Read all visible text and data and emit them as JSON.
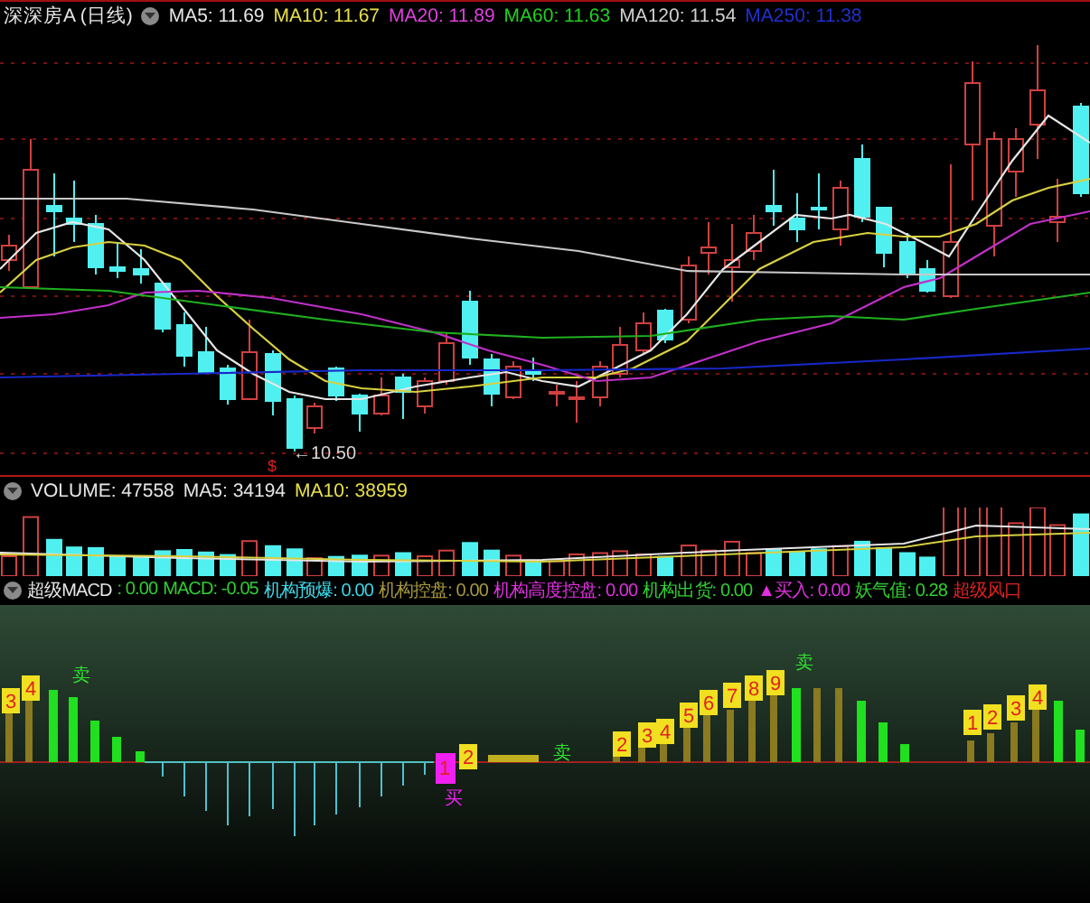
{
  "main_panel": {
    "title": "深深房A (日线)",
    "indicators": [
      {
        "label": "MA5: 11.69",
        "color": "#e6e6e6"
      },
      {
        "label": "MA10: 11.67",
        "color": "#e8e04a"
      },
      {
        "label": "MA20: 11.89",
        "color": "#e040e0"
      },
      {
        "label": "MA60: 11.63",
        "color": "#20d020"
      },
      {
        "label": "MA120: 11.54",
        "color": "#d0d0d0"
      },
      {
        "label": "MA250: 11.38",
        "color": "#2030d0"
      }
    ],
    "low_marker": "←10.50",
    "signal_marker": "$"
  },
  "volume_panel": {
    "indicators": [
      {
        "label": "VOLUME: 47558",
        "color": "#e6e6e6"
      },
      {
        "label": "MA5: 34194",
        "color": "#e6e6e6"
      },
      {
        "label": "MA10: 38959",
        "color": "#e8e04a"
      }
    ]
  },
  "macd_panel": {
    "title": "超级MACD",
    "indicators": [
      {
        "label": ": 0.00",
        "color": "#30d030"
      },
      {
        "label": "MACD: -0.05",
        "color": "#30d030"
      },
      {
        "label": "机构预爆: 0.00",
        "color": "#40d8e8"
      },
      {
        "label": "机构控盘: 0.00",
        "color": "#a89a40"
      },
      {
        "label": "机构高度控盘: 0.00",
        "color": "#e030e0"
      },
      {
        "label": "机构出货: 0.00",
        "color": "#30d030"
      },
      {
        "label": "▲买入: 0.00",
        "color": "#e030e0"
      },
      {
        "label": "妖气值: 0.28",
        "color": "#30d030"
      },
      {
        "label": "超级风口",
        "color": "#e02020"
      }
    ],
    "signals": [
      {
        "text": "3",
        "kind": "count"
      },
      {
        "text": "4",
        "kind": "count"
      },
      {
        "text": "卖",
        "kind": "sell"
      },
      {
        "text": "1",
        "kind": "buy_count"
      },
      {
        "text": "买",
        "kind": "buy"
      },
      {
        "text": "2",
        "kind": "count"
      },
      {
        "text": "卖",
        "kind": "sell"
      },
      {
        "text": "2",
        "kind": "count"
      },
      {
        "text": "3",
        "kind": "count"
      },
      {
        "text": "4",
        "kind": "count"
      },
      {
        "text": "5",
        "kind": "count"
      },
      {
        "text": "6",
        "kind": "count"
      },
      {
        "text": "7",
        "kind": "count"
      },
      {
        "text": "8",
        "kind": "count"
      },
      {
        "text": "9",
        "kind": "count"
      },
      {
        "text": "卖",
        "kind": "sell"
      },
      {
        "text": "1",
        "kind": "count"
      },
      {
        "text": "2",
        "kind": "count"
      },
      {
        "text": "3",
        "kind": "count"
      },
      {
        "text": "4",
        "kind": "count"
      }
    ]
  }
}
